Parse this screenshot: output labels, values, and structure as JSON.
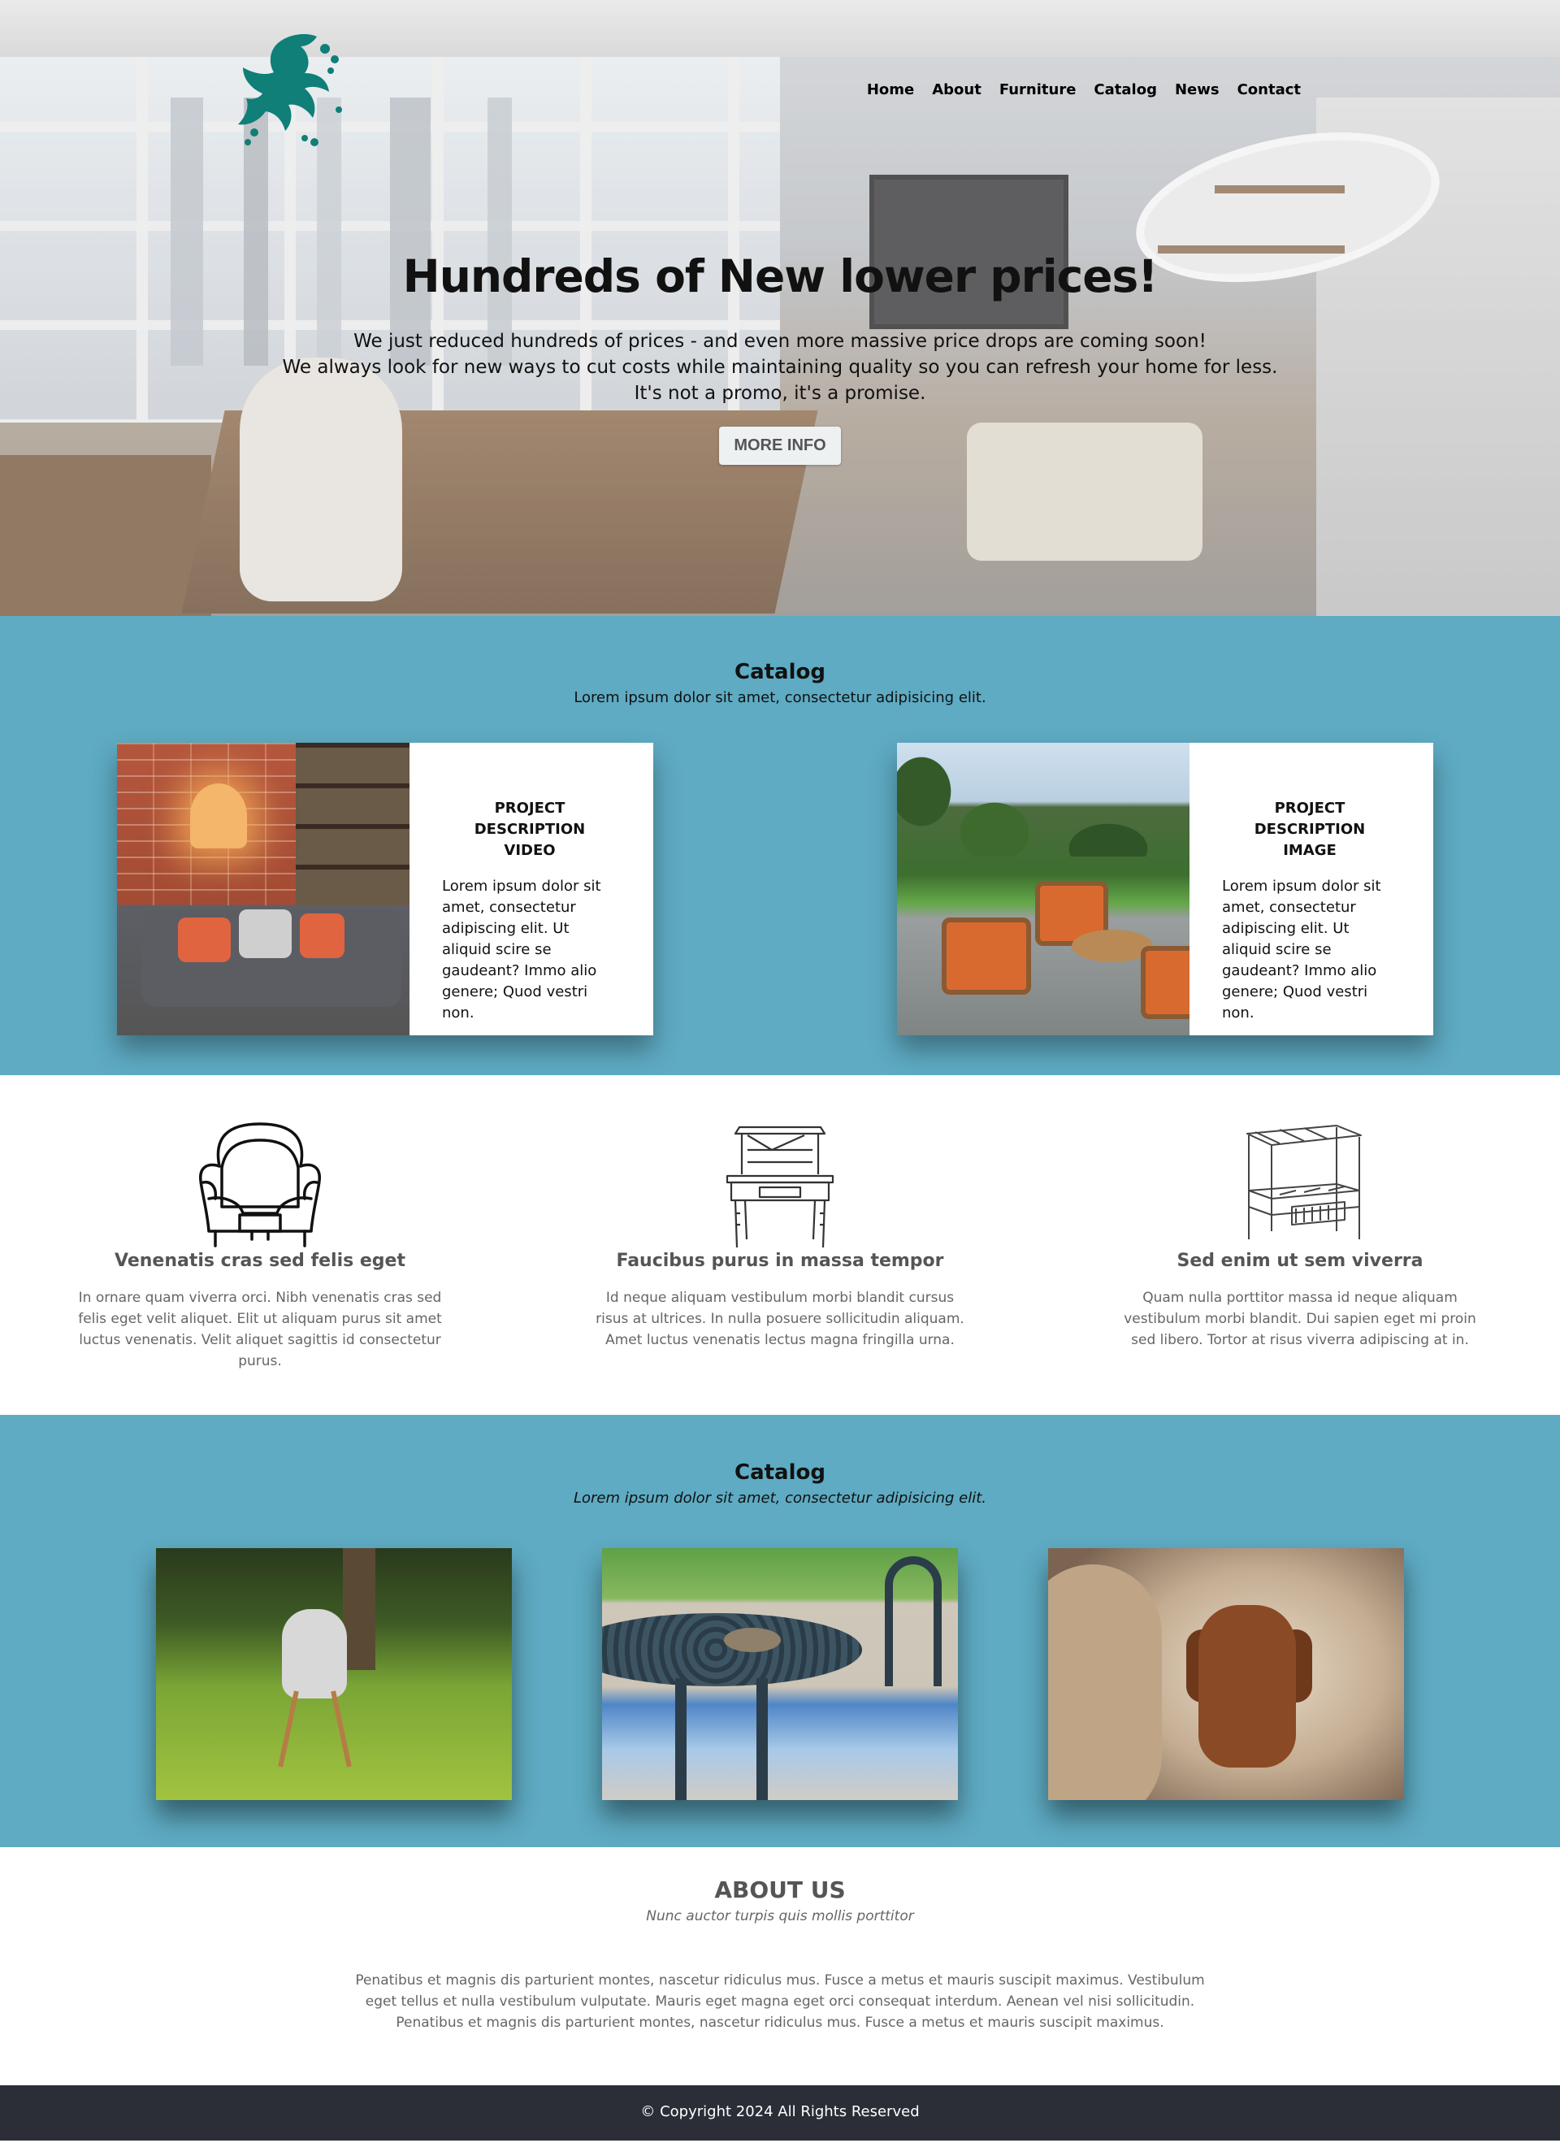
{
  "nav": {
    "items": [
      "Home",
      "About",
      "Furniture",
      "Catalog",
      "News",
      "Contact"
    ]
  },
  "hero": {
    "title": "Hundreds of New lower prices!",
    "lines": [
      "We just reduced hundreds of prices - and even more massive price drops are coming soon!",
      "We always look for new ways to cut costs while maintaining quality so you can refresh your home for less.",
      "It's not a promo, it's a promise."
    ],
    "button": "MORE INFO"
  },
  "catalog1": {
    "title": "Catalog",
    "subtitle": "Lorem ipsum dolor sit amet, consectetur adipisicing elit.",
    "cards": [
      {
        "title_line1": "PROJECT DESCRIPTION",
        "title_line2": "VIDEO",
        "text": "Lorem ipsum dolor sit amet, consectetur adipiscing elit. Ut aliquid scire se gaudeant? Immo alio genere; Quod vestri non."
      },
      {
        "title_line1": "PROJECT DESCRIPTION",
        "title_line2": "IMAGE",
        "text": "Lorem ipsum dolor sit amet, consectetur adipiscing elit. Ut aliquid scire se gaudeant? Immo alio genere; Quod vestri non."
      }
    ]
  },
  "features": [
    {
      "icon": "armchair-icon",
      "title": "Venenatis cras sed felis eget",
      "text": "In ornare quam viverra orci. Nibh venenatis cras sed felis eget velit aliquet. Elit ut aliquam purus sit amet luctus venenatis. Velit aliquet sagittis id consectetur purus."
    },
    {
      "icon": "hutch-desk-icon",
      "title": "Faucibus purus in massa tempor",
      "text": "Id neque aliquam vestibulum morbi blandit cursus risus at ultrices. In nulla posuere sollicitudin aliquam. Amet luctus venenatis lectus magna fringilla urna."
    },
    {
      "icon": "canopy-bed-icon",
      "title": "Sed enim ut sem viverra",
      "text": "Quam nulla porttitor massa id neque aliquam vestibulum morbi blandit. Dui sapien eget mi proin sed libero. Tortor at risus viverra adipiscing at in."
    }
  ],
  "catalog2": {
    "title": "Catalog",
    "subtitle": "Lorem ipsum dolor sit amet, consectetur adipisicing elit."
  },
  "about": {
    "title": "ABOUT US",
    "tagline": "Nunc auctor turpis quis mollis porttitor",
    "text": "Penatibus et magnis dis parturient montes, nascetur ridiculus mus. Fusce a metus et mauris suscipit maximus. Vestibulum eget tellus et nulla vestibulum vulputate. Mauris eget magna eget orci consequat interdum. Aenean vel nisi sollicitudin. Penatibus et magnis dis parturient montes, nascetur ridiculus mus. Fusce a metus et mauris suscipit maximus."
  },
  "footer": {
    "copyright": "© Copyright 2024 All Rights Reserved"
  },
  "colors": {
    "teal_section": "#5eabc3",
    "logo": "#0f7f78",
    "footer": "#2b2e36"
  }
}
